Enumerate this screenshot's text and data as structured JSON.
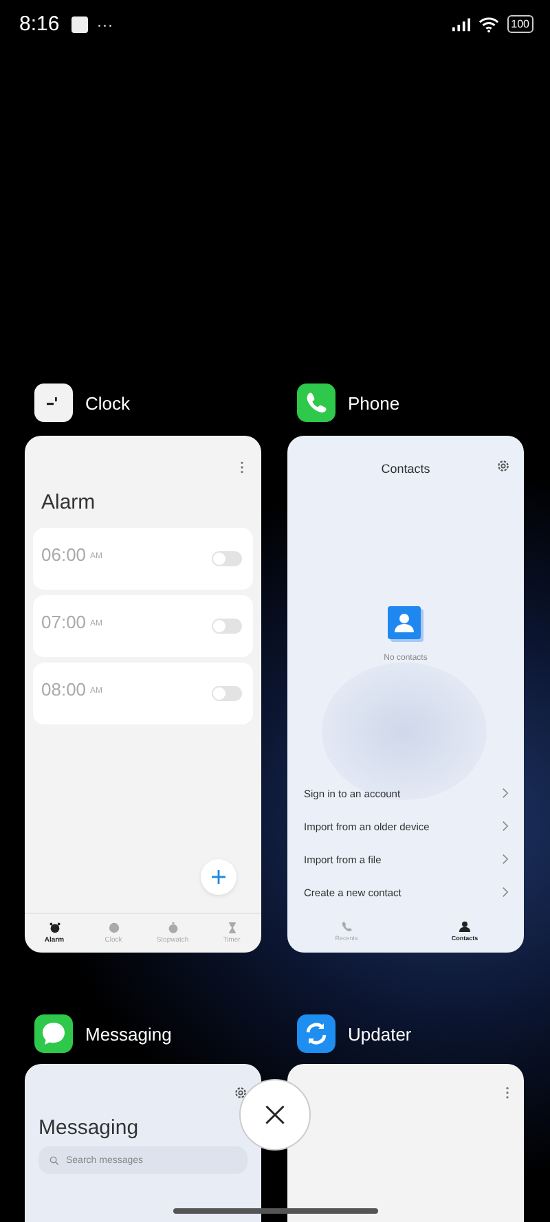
{
  "status_bar": {
    "time": "8:16",
    "more": "···",
    "battery": "100"
  },
  "apps": [
    {
      "kind": "clock",
      "name": "Clock",
      "title": "Alarm",
      "alarms": [
        {
          "time": "06:00",
          "period": "AM",
          "on": false
        },
        {
          "time": "07:00",
          "period": "AM",
          "on": false
        },
        {
          "time": "08:00",
          "period": "AM",
          "on": false
        }
      ],
      "tabs": [
        {
          "label": "Alarm",
          "selected": true
        },
        {
          "label": "Clock",
          "selected": false
        },
        {
          "label": "Stopwatch",
          "selected": false
        },
        {
          "label": "Timer",
          "selected": false
        }
      ]
    },
    {
      "kind": "phone",
      "name": "Phone",
      "title": "Contacts",
      "empty_text": "No contacts",
      "options": [
        "Sign in to an account",
        "Import from an older device",
        "Import from a file",
        "Create a new contact"
      ],
      "tabs": [
        {
          "label": "Recents",
          "selected": false
        },
        {
          "label": "Contacts",
          "selected": true
        }
      ]
    },
    {
      "kind": "messaging",
      "name": "Messaging",
      "title": "Messaging",
      "search": {
        "placeholder": "Search messages"
      }
    },
    {
      "kind": "updater",
      "name": "Updater"
    }
  ]
}
